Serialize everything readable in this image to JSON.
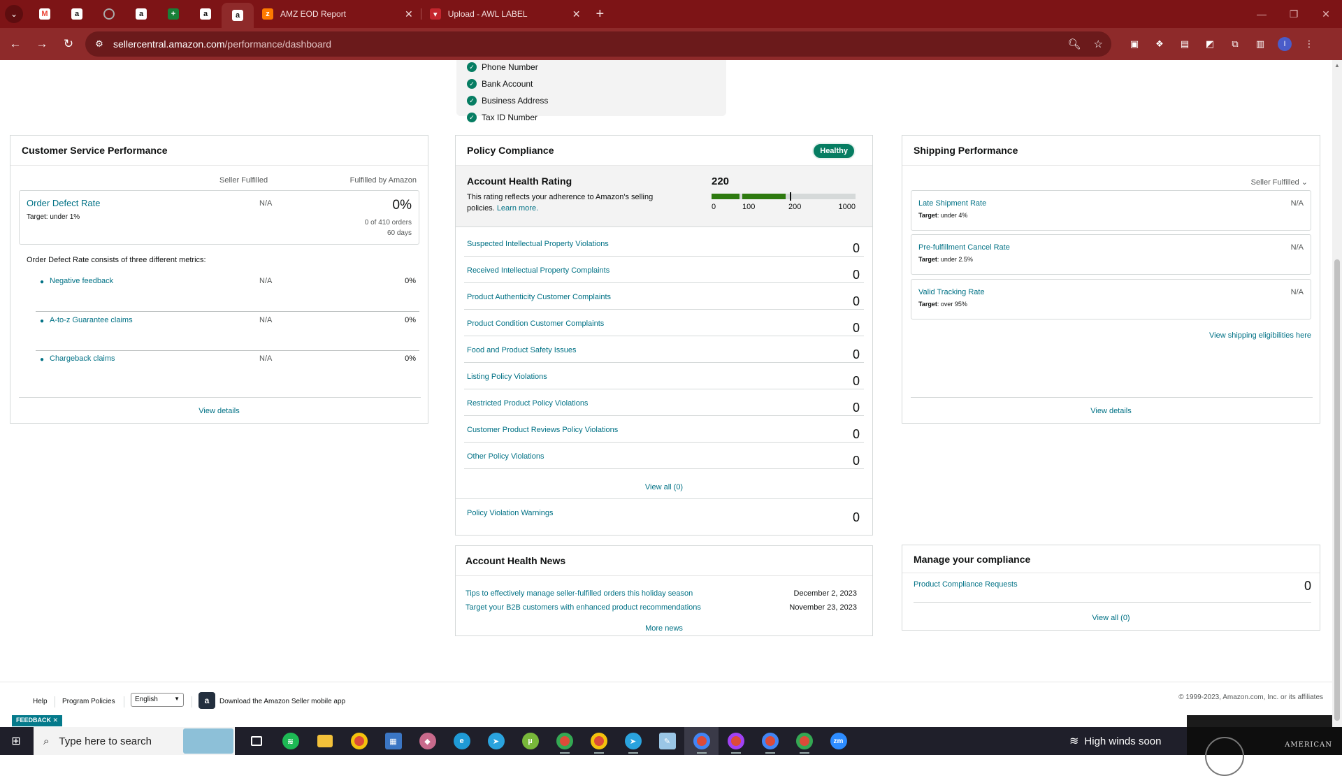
{
  "browser": {
    "tabs": [
      {
        "title": "AMZ EOD Report",
        "favicon": "zapier-icon"
      },
      {
        "title": "Upload - AWL LABEL",
        "favicon": "ups-icon"
      }
    ],
    "url_domain": "sellercentral.amazon.com",
    "url_path": "/performance/dashboard",
    "profile_initial": "I"
  },
  "identity": {
    "items": [
      "Phone Number",
      "Bank Account",
      "Business Address",
      "Tax ID Number"
    ]
  },
  "customer_service": {
    "title": "Customer Service Performance",
    "col_seller": "Seller Fulfilled",
    "col_fba": "Fulfilled by Amazon",
    "odr": {
      "title": "Order Defect Rate",
      "target_label": "Target",
      "target_value": ": under 1%",
      "seller_value": "N/A",
      "fba_value": "0%",
      "fba_orders": "0 of 410 orders",
      "fba_period": "60 days"
    },
    "description": "Order Defect Rate consists of three different metrics:",
    "metrics": [
      {
        "name": "Negative feedback",
        "seller": "N/A",
        "fba": "0%"
      },
      {
        "name": "A-to-z Guarantee claims",
        "seller": "N/A",
        "fba": "0%"
      },
      {
        "name": "Chargeback claims",
        "seller": "N/A",
        "fba": "0%"
      }
    ],
    "view_details": "View details"
  },
  "policy": {
    "title": "Policy Compliance",
    "status": "Healthy",
    "ahr": {
      "title": "Account Health Rating",
      "description": "This rating reflects your adherence to Amazon's selling policies.",
      "learn_more": "Learn more.",
      "score": "220",
      "score_value": 220,
      "ticks": [
        "0",
        "100",
        "200",
        "1000"
      ]
    },
    "violations": [
      {
        "name": "Suspected Intellectual Property Violations",
        "count": "0"
      },
      {
        "name": "Received Intellectual Property Complaints",
        "count": "0"
      },
      {
        "name": "Product Authenticity Customer Complaints",
        "count": "0"
      },
      {
        "name": "Product Condition Customer Complaints",
        "count": "0"
      },
      {
        "name": "Food and Product Safety Issues",
        "count": "0"
      },
      {
        "name": "Listing Policy Violations",
        "count": "0"
      },
      {
        "name": "Restricted Product Policy Violations",
        "count": "0"
      },
      {
        "name": "Customer Product Reviews Policy Violations",
        "count": "0"
      },
      {
        "name": "Other Policy Violations",
        "count": "0"
      }
    ],
    "view_all": "View all (0)",
    "warnings": {
      "name": "Policy Violation Warnings",
      "count": "0"
    }
  },
  "news": {
    "title": "Account Health News",
    "items": [
      {
        "title": "Tips to effectively manage seller-fulfilled orders this holiday season",
        "date": "December 2, 2023"
      },
      {
        "title": "Target your B2B customers with enhanced product recommendations",
        "date": "November 23, 2023"
      }
    ],
    "more": "More news"
  },
  "shipping": {
    "title": "Shipping Performance",
    "dropdown": "Seller Fulfilled",
    "metrics": [
      {
        "name": "Late Shipment Rate",
        "target_label": "Target",
        "target_value": ": under 4%",
        "value": "N/A"
      },
      {
        "name": "Pre-fulfillment Cancel Rate",
        "target_label": "Target",
        "target_value": ": under 2.5%",
        "value": "N/A"
      },
      {
        "name": "Valid Tracking Rate",
        "target_label": "Target",
        "target_value": ": over 95%",
        "value": "N/A"
      }
    ],
    "eligibilities": "View shipping eligibilities here",
    "view_details": "View details"
  },
  "compliance": {
    "title": "Manage your compliance",
    "row": {
      "name": "Product Compliance Requests",
      "count": "0"
    },
    "view_all": "View all (0)"
  },
  "footer": {
    "help": "Help",
    "policies": "Program Policies",
    "language": "English",
    "app": "Download the Amazon Seller mobile app",
    "copyright": "© 1999-2023, Amazon.com, Inc. or its affiliates"
  },
  "feedback": "FEEDBACK",
  "taskbar": {
    "search_placeholder": "Type here to search",
    "weather": "High winds soon",
    "tray_text": "AMERICAN"
  }
}
